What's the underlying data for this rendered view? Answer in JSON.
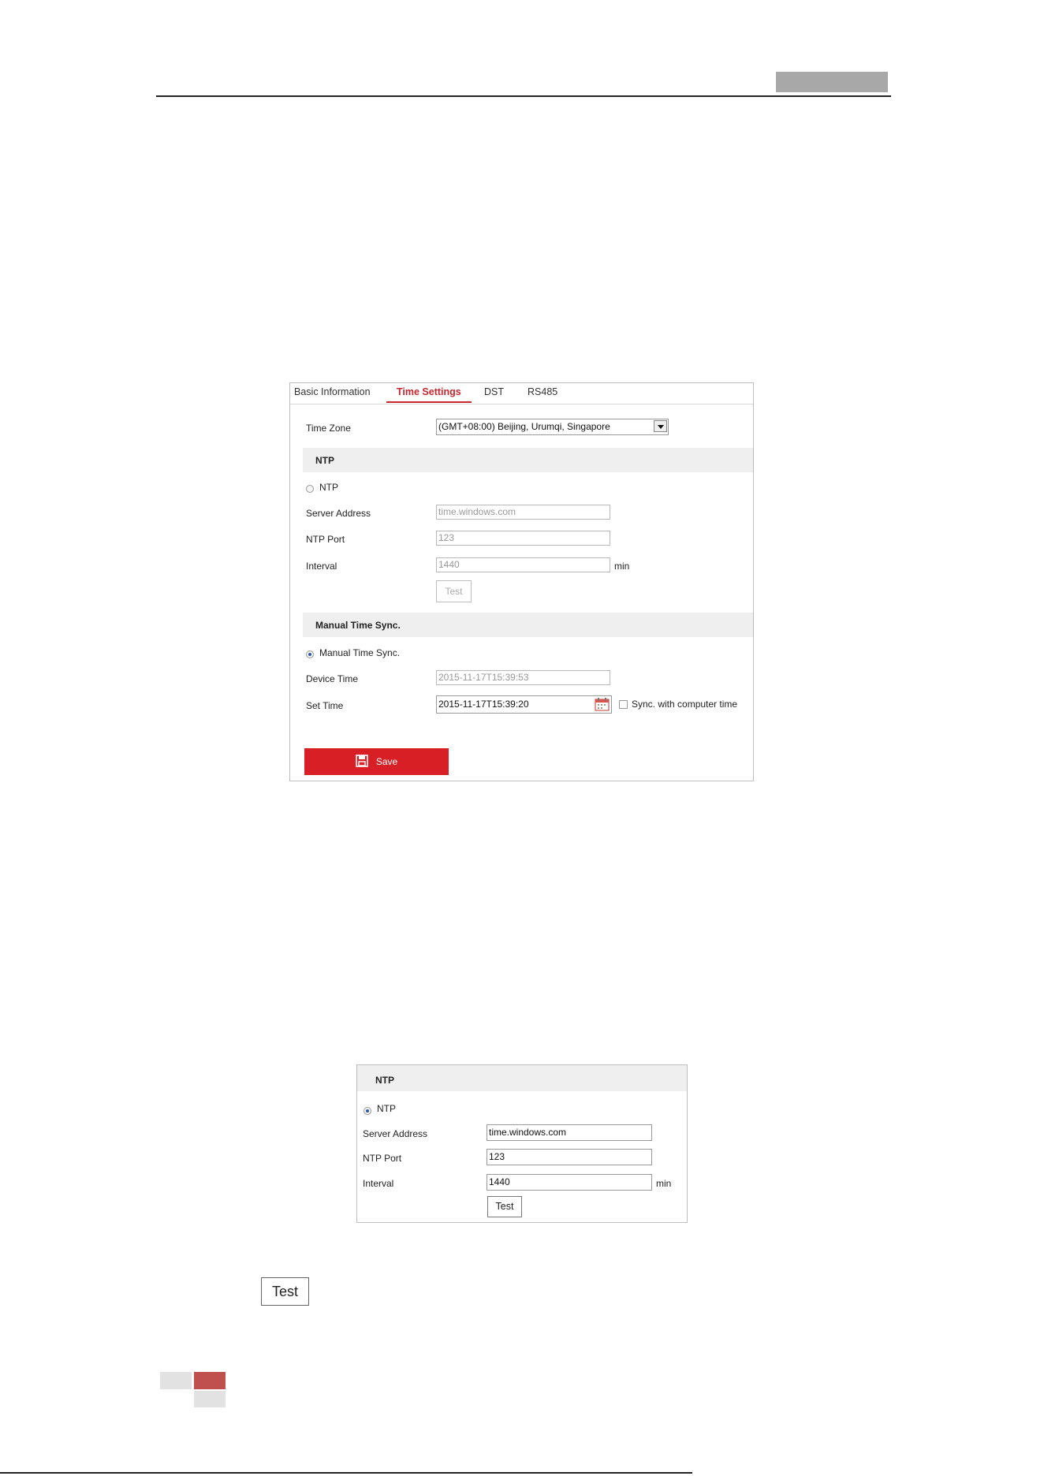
{
  "panel1": {
    "tabs": [
      "Basic Information",
      "Time Settings",
      "DST",
      "RS485"
    ],
    "time_zone_label": "Time Zone",
    "time_zone_value": "(GMT+08:00) Beijing, Urumqi, Singapore",
    "ntp_section": "NTP",
    "ntp_radio": "NTP",
    "server_address_label": "Server Address",
    "server_address_value": "time.windows.com",
    "ntp_port_label": "NTP Port",
    "ntp_port_value": "123",
    "interval_label": "Interval",
    "interval_value": "1440",
    "min_label": "min",
    "test_button": "Test",
    "manual_section": "Manual Time Sync.",
    "manual_radio": "Manual Time Sync.",
    "device_time_label": "Device Time",
    "device_time_value": "2015-11-17T15:39:53",
    "set_time_label": "Set Time",
    "set_time_value": "2015-11-17T15:39:20",
    "sync_label": "Sync. with computer time",
    "save_button": "Save"
  },
  "panel2": {
    "ntp_section": "NTP",
    "ntp_radio": "NTP",
    "server_address_label": "Server Address",
    "server_address_value": "time.windows.com",
    "ntp_port_label": "NTP Port",
    "ntp_port_value": "123",
    "interval_label": "Interval",
    "interval_value": "1440",
    "min_label": "min",
    "test_button": "Test"
  },
  "standalone_test_button": "Test"
}
